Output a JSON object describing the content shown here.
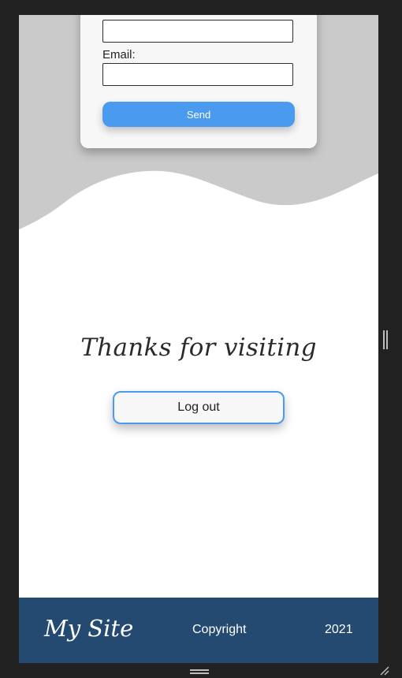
{
  "form": {
    "email_label": "Email:",
    "name_value": "",
    "email_value": "",
    "send_label": "Send"
  },
  "main": {
    "thanks_text": "Thanks for visiting",
    "logout_label": "Log out"
  },
  "footer": {
    "brand": "My Site",
    "copyright": "Copyright",
    "year": "2021"
  },
  "icons": {
    "side_handle": "vertical-resize-handle-icon",
    "bottom_handle": "horizontal-resize-handle-icon",
    "corner": "resize-corner-icon"
  },
  "colors": {
    "background": "#222222",
    "wave_grey": "#cacaca",
    "accent": "#4a9bf0",
    "footer_bg": "#244a72"
  }
}
